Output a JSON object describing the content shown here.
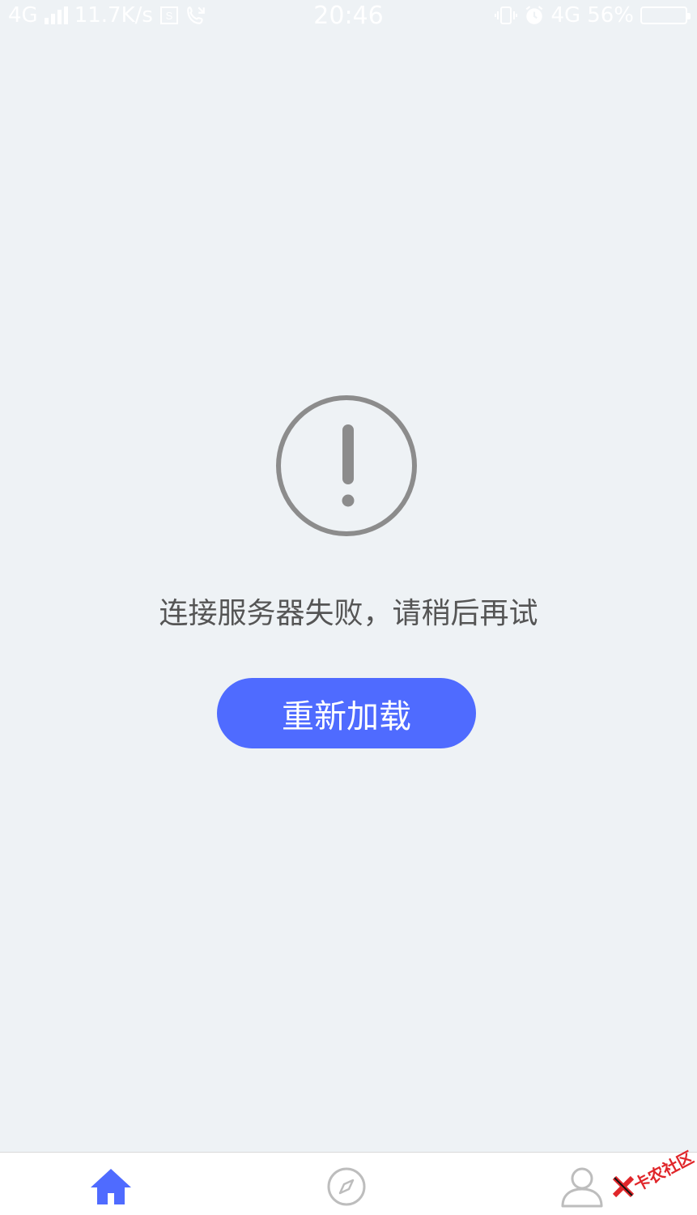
{
  "status_bar": {
    "network_type": "4G",
    "net_speed": "11.7K/s",
    "time": "20:46",
    "network_type_right": "4G",
    "battery_percent": "56%"
  },
  "error": {
    "icon": "exclamation-circle-icon",
    "message": "连接服务器失败，请稍后再试",
    "reload_label": "重新加载"
  },
  "bottom_nav": {
    "items": [
      {
        "icon": "home-icon",
        "active": true
      },
      {
        "icon": "compass-icon",
        "active": false
      },
      {
        "icon": "user-icon",
        "active": false
      }
    ]
  },
  "watermark": {
    "text": "卡农社区"
  },
  "colors": {
    "background": "#eef2f5",
    "accent": "#4f6bff",
    "icon_gray": "#8c8c8c",
    "inactive_nav": "#bdbdbd",
    "watermark_red": "#e0262a"
  }
}
